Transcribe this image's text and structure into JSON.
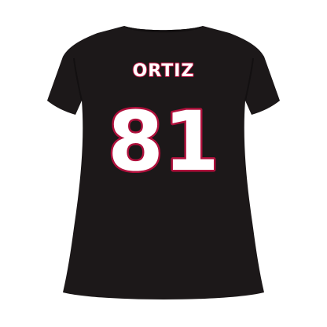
{
  "shirt": {
    "player_name": "ORTIZ",
    "player_number": "81"
  },
  "colors": {
    "background": "#ffffff",
    "shirt_fabric": "#1c1819",
    "shirt_shadow": "#131011",
    "lettering_fill": "#ffffff",
    "lettering_outline": "#b0103c"
  }
}
